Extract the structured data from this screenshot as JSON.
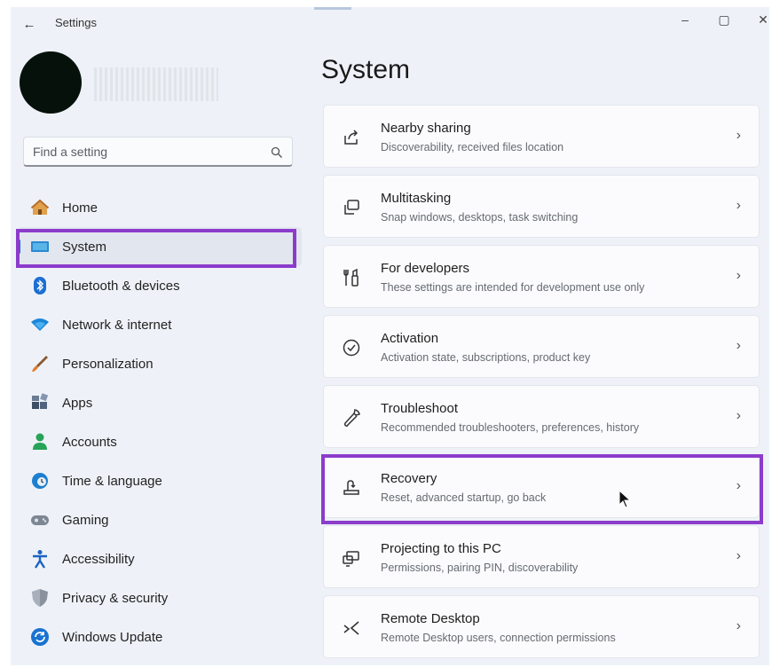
{
  "window": {
    "back_glyph": "←",
    "title": "Settings",
    "controls": {
      "minimize": "–",
      "maximize": "▢",
      "close": "✕"
    }
  },
  "search": {
    "placeholder": "Find a setting",
    "icon": "search-icon"
  },
  "sidebar": {
    "items": [
      {
        "label": "Home",
        "icon": "home-icon",
        "active": false
      },
      {
        "label": "System",
        "icon": "system-monitor-icon",
        "active": true
      },
      {
        "label": "Bluetooth & devices",
        "icon": "bluetooth-icon",
        "active": false
      },
      {
        "label": "Network & internet",
        "icon": "wifi-icon",
        "active": false
      },
      {
        "label": "Personalization",
        "icon": "brush-icon",
        "active": false
      },
      {
        "label": "Apps",
        "icon": "apps-icon",
        "active": false
      },
      {
        "label": "Accounts",
        "icon": "person-icon",
        "active": false
      },
      {
        "label": "Time & language",
        "icon": "globe-clock-icon",
        "active": false
      },
      {
        "label": "Gaming",
        "icon": "gamepad-icon",
        "active": false
      },
      {
        "label": "Accessibility",
        "icon": "accessibility-icon",
        "active": false
      },
      {
        "label": "Privacy & security",
        "icon": "shield-icon",
        "active": false
      },
      {
        "label": "Windows Update",
        "icon": "update-icon",
        "active": false
      }
    ]
  },
  "main": {
    "title": "System",
    "cards": [
      {
        "title": "Nearby sharing",
        "desc": "Discoverability, received files location",
        "icon": "share-icon"
      },
      {
        "title": "Multitasking",
        "desc": "Snap windows, desktops, task switching",
        "icon": "multitasking-icon"
      },
      {
        "title": "For developers",
        "desc": "These settings are intended for development use only",
        "icon": "developer-tools-icon"
      },
      {
        "title": "Activation",
        "desc": "Activation state, subscriptions, product key",
        "icon": "check-circle-icon"
      },
      {
        "title": "Troubleshoot",
        "desc": "Recommended troubleshooters, preferences, history",
        "icon": "wrench-icon"
      },
      {
        "title": "Recovery",
        "desc": "Reset, advanced startup, go back",
        "icon": "recovery-icon"
      },
      {
        "title": "Projecting to this PC",
        "desc": "Permissions, pairing PIN, discoverability",
        "icon": "projecting-icon"
      },
      {
        "title": "Remote Desktop",
        "desc": "Remote Desktop users, connection permissions",
        "icon": "remote-desktop-icon"
      }
    ],
    "chevron": "›"
  },
  "colors": {
    "highlight": "#8c3ccb",
    "accent": "#1e6fd0",
    "background": "#eef2f8",
    "card": "#fbfbfd"
  }
}
